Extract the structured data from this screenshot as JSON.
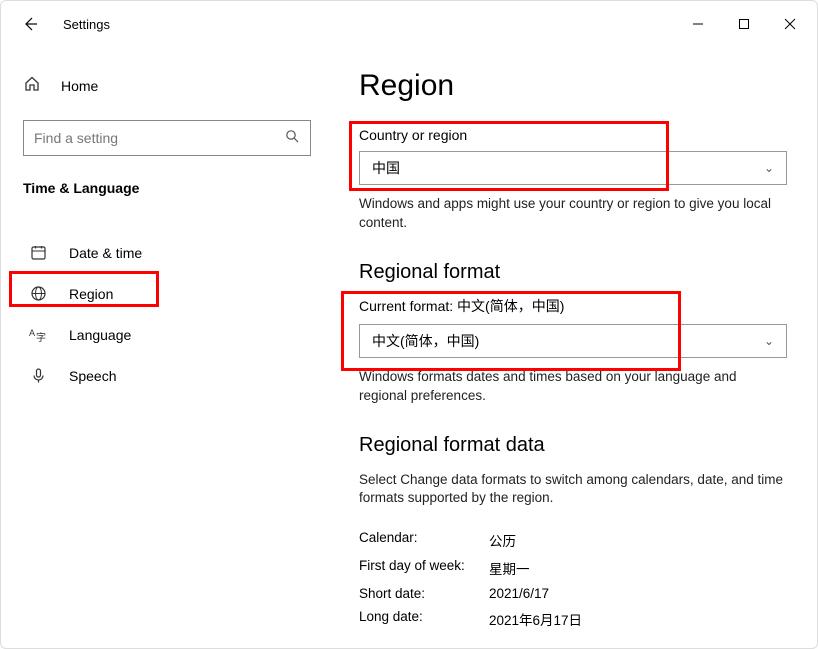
{
  "titlebar": {
    "title": "Settings"
  },
  "sidebar": {
    "home": "Home",
    "search_placeholder": "Find a setting",
    "category": "Time & Language",
    "items": [
      {
        "label": "Date & time"
      },
      {
        "label": "Region"
      },
      {
        "label": "Language"
      },
      {
        "label": "Speech"
      }
    ]
  },
  "main": {
    "title": "Region",
    "country_label": "Country or region",
    "country_value": "中国",
    "country_desc": "Windows and apps might use your country or region to give you local content.",
    "regional_format_heading": "Regional format",
    "current_format_prefix": "Current format: ",
    "current_format_value": "中文(简体，中国)",
    "format_dropdown_value": "中文(简体，中国)",
    "format_desc": "Windows formats dates and times based on your language and regional preferences.",
    "regional_data_heading": "Regional format data",
    "regional_data_desc": "Select Change data formats to switch among calendars, date, and time formats supported by the region.",
    "rows": [
      {
        "k": "Calendar:",
        "v": "公历"
      },
      {
        "k": "First day of week:",
        "v": "星期一"
      },
      {
        "k": "Short date:",
        "v": "2021/6/17"
      },
      {
        "k": "Long date:",
        "v": "2021年6月17日"
      }
    ]
  }
}
